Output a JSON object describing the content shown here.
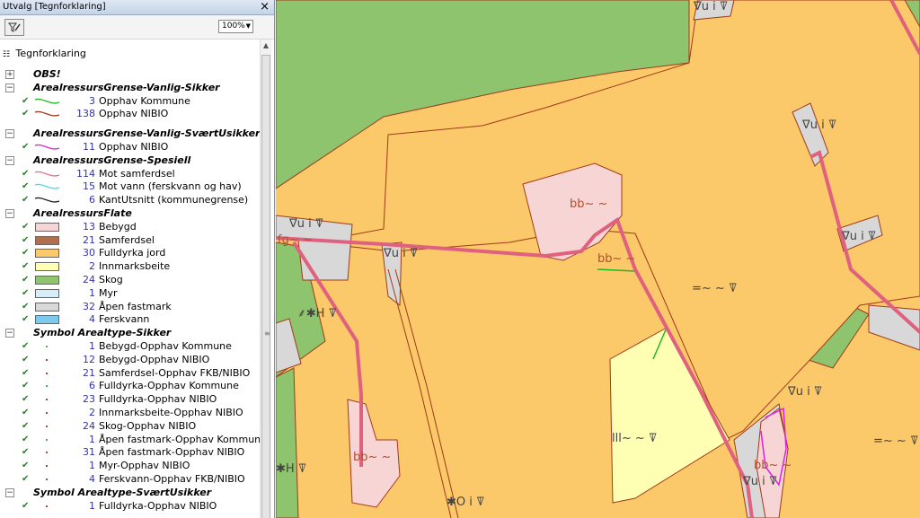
{
  "panel": {
    "title": "Utvalg [Tegnforklaring]",
    "close_label": "×",
    "zoom_value": "100%",
    "legend_title": "Tegnforklaring"
  },
  "legend": {
    "groups": [
      {
        "name": "OBS!",
        "toggle": "+",
        "items": []
      },
      {
        "name": "ArealressursGrense-Vanlig-Sikker",
        "toggle": "−",
        "items": [
          {
            "count": "3",
            "label": "Opphav Kommune",
            "kind": "line",
            "color": "#22b822"
          },
          {
            "count": "138",
            "label": "Opphav NIBIO",
            "kind": "line",
            "color": "#a03a1a"
          }
        ]
      },
      {
        "name": "ArealressursGrense-Vanlig-SværtUsikker",
        "toggle": "−",
        "items": [
          {
            "count": "11",
            "label": "Opphav NIBIO",
            "kind": "line",
            "color": "#e020e0"
          }
        ]
      },
      {
        "name": "ArealressursGrense-Spesiell",
        "toggle": "−",
        "items": [
          {
            "count": "114",
            "label": "Mot samferdsel",
            "kind": "line",
            "color": "#f06d8c"
          },
          {
            "count": "15",
            "label": "Mot vann (ferskvann og hav)",
            "kind": "line",
            "color": "#4fd7e7"
          },
          {
            "count": "6",
            "label": "KantUtsnitt (kommunegrense)",
            "kind": "line",
            "color": "#222222"
          }
        ]
      },
      {
        "name": "ArealressursFlate",
        "toggle": "−",
        "items": [
          {
            "count": "13",
            "label": "Bebygd",
            "kind": "fill",
            "color": "#f8d5d5"
          },
          {
            "count": "21",
            "label": "Samferdsel",
            "kind": "fill",
            "color": "#b07050"
          },
          {
            "count": "30",
            "label": "Fulldyrka jord",
            "kind": "fill",
            "color": "#fbc86a"
          },
          {
            "count": "2",
            "label": "Innmarksbeite",
            "kind": "fill",
            "color": "#ffffb4"
          },
          {
            "count": "24",
            "label": "Skog",
            "kind": "fill",
            "color": "#8ec46e"
          },
          {
            "count": "1",
            "label": "Myr",
            "kind": "fill",
            "color": "#d6eef8"
          },
          {
            "count": "32",
            "label": "Åpen fastmark",
            "kind": "fill",
            "color": "#d8d8d8"
          },
          {
            "count": "4",
            "label": "Ferskvann",
            "kind": "fill",
            "color": "#7ccaf0"
          }
        ]
      },
      {
        "name": "Symbol Arealtype-Sikker",
        "toggle": "−",
        "items": [
          {
            "count": "1",
            "label": "Bebygd-Opphav Kommune",
            "kind": "dot",
            "color": "#4caf50"
          },
          {
            "count": "12",
            "label": "Bebygd-Opphav NIBIO",
            "kind": "dot",
            "color": "#c0392b"
          },
          {
            "count": "21",
            "label": "Samferdsel-Opphav FKB/NIBIO",
            "kind": "dot",
            "color": "#c0392b"
          },
          {
            "count": "6",
            "label": "Fulldyrka-Opphav Kommune",
            "kind": "dot",
            "color": "#4caf50"
          },
          {
            "count": "23",
            "label": "Fulldyrka-Opphav NIBIO",
            "kind": "dot",
            "color": "#c0392b"
          },
          {
            "count": "2",
            "label": "Innmarksbeite-Opphav NIBIO",
            "kind": "dot",
            "color": "#c0392b"
          },
          {
            "count": "24",
            "label": "Skog-Opphav NIBIO",
            "kind": "dot",
            "color": "#c0392b"
          },
          {
            "count": "1",
            "label": "Åpen fastmark-Opphav Kommune",
            "kind": "dot",
            "color": "#4caf50"
          },
          {
            "count": "31",
            "label": "Åpen fastmark-Opphav NIBIO",
            "kind": "dot",
            "color": "#c0392b"
          },
          {
            "count": "1",
            "label": "Myr-Opphav NIBIO",
            "kind": "dot",
            "color": "#c0392b"
          },
          {
            "count": "4",
            "label": "Ferskvann-Opphav FKB/NIBIO",
            "kind": "dot",
            "color": "#c0392b"
          }
        ]
      },
      {
        "name": "Symbol Arealtype-SværtUsikker",
        "toggle": "−",
        "items": [
          {
            "count": "1",
            "label": "Fulldyrka-Opphav NIBIO",
            "kind": "dot",
            "color": "#c0392b"
          }
        ]
      }
    ]
  },
  "map": {
    "labels": [
      {
        "id": "lbl-vui-top",
        "text": "∇u i ꘜ"
      },
      {
        "id": "lbl-vui-right-upper",
        "text": "∇u i ꘜ"
      },
      {
        "id": "lbl-bb-upper",
        "text": "bb~ ~"
      },
      {
        "id": "lbl-vui-left",
        "text": "∇u i ꘜ"
      },
      {
        "id": "lbl-fg",
        "text": "fg~ ~"
      },
      {
        "id": "lbl-vui-mid",
        "text": "∇u i ꘜ"
      },
      {
        "id": "lbl-bb-road",
        "text": "bb~ ~"
      },
      {
        "id": "lbl-vui-right-mid",
        "text": "∇u i ꘜ"
      },
      {
        "id": "lbl-field-east",
        "text": "=~ ~ ꘜ"
      },
      {
        "id": "lbl-forest-h",
        "text": "⸙✱H ꘜ"
      },
      {
        "id": "lbl-vui-lower",
        "text": "∇u i ꘜ"
      },
      {
        "id": "lbl-beite",
        "text": "lll~ ~ ꘜ"
      },
      {
        "id": "lbl-field-se",
        "text": "=~ ~ ꘜ"
      },
      {
        "id": "lbl-bb-lower",
        "text": "bb~ ~"
      },
      {
        "id": "lbl-bb-right",
        "text": "bb~ ~"
      },
      {
        "id": "lbl-vui-bottom",
        "text": "∇u i ꘜ"
      },
      {
        "id": "lbl-h-left",
        "text": "✱H ꘜ"
      },
      {
        "id": "lbl-oi",
        "text": "✱O i ꘜ"
      }
    ]
  }
}
